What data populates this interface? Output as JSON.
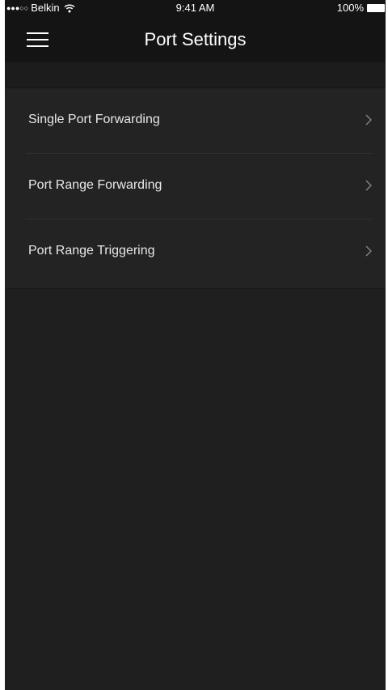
{
  "status_bar": {
    "signal_dots": "●●●○○",
    "carrier": "Belkin",
    "wifi_icon": "wifi-icon",
    "time": "9:41 AM",
    "battery_percent": "100%",
    "battery_level": 1.0
  },
  "header": {
    "menu_icon": "hamburger-menu-icon",
    "title": "Port Settings"
  },
  "settings": {
    "items": [
      {
        "label": "Single Port Forwarding",
        "icon": "chevron-right-icon"
      },
      {
        "label": "Port Range Forwarding",
        "icon": "chevron-right-icon"
      },
      {
        "label": "Port Range Triggering",
        "icon": "chevron-right-icon"
      }
    ]
  },
  "colors": {
    "background": "#1f1f1f",
    "header_background": "#141414",
    "list_background": "#232323",
    "text": "#e8e8e8",
    "chevron": "#8a8a8a"
  }
}
